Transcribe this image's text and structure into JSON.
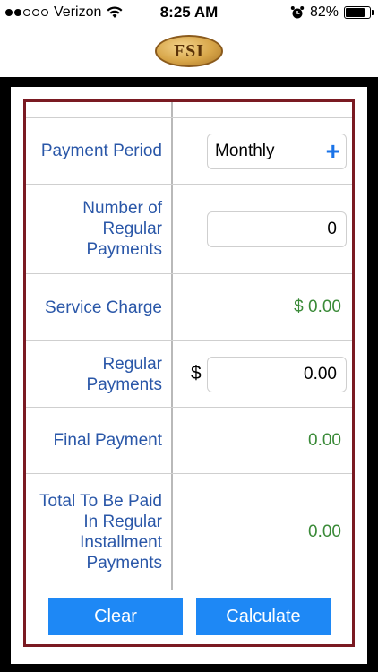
{
  "status_bar": {
    "carrier": "Verizon",
    "time": "8:25 AM",
    "battery": "82%",
    "battery_level": 0.82
  },
  "header": {
    "logo_text": "FSI"
  },
  "form": {
    "payment_period": {
      "label": "Payment Period",
      "value": "Monthly"
    },
    "number_of_payments": {
      "label": "Number of Regular Payments",
      "value": "0"
    },
    "service_charge": {
      "label": "Service Charge",
      "value": "$ 0.00"
    },
    "regular_payments": {
      "label": "Regular Payments",
      "currency": "$",
      "value": "0.00"
    },
    "final_payment": {
      "label": "Final Payment",
      "value": "0.00"
    },
    "total_paid": {
      "label": "Total To Be Paid In Regular Installment Payments",
      "value": "0.00"
    }
  },
  "buttons": {
    "clear": "Clear",
    "calculate": "Calculate"
  },
  "colors": {
    "label_blue": "#2a57a8",
    "value_green": "#3a8a38",
    "button_blue": "#1e88f5",
    "frame_maroon": "#7a1a22"
  }
}
